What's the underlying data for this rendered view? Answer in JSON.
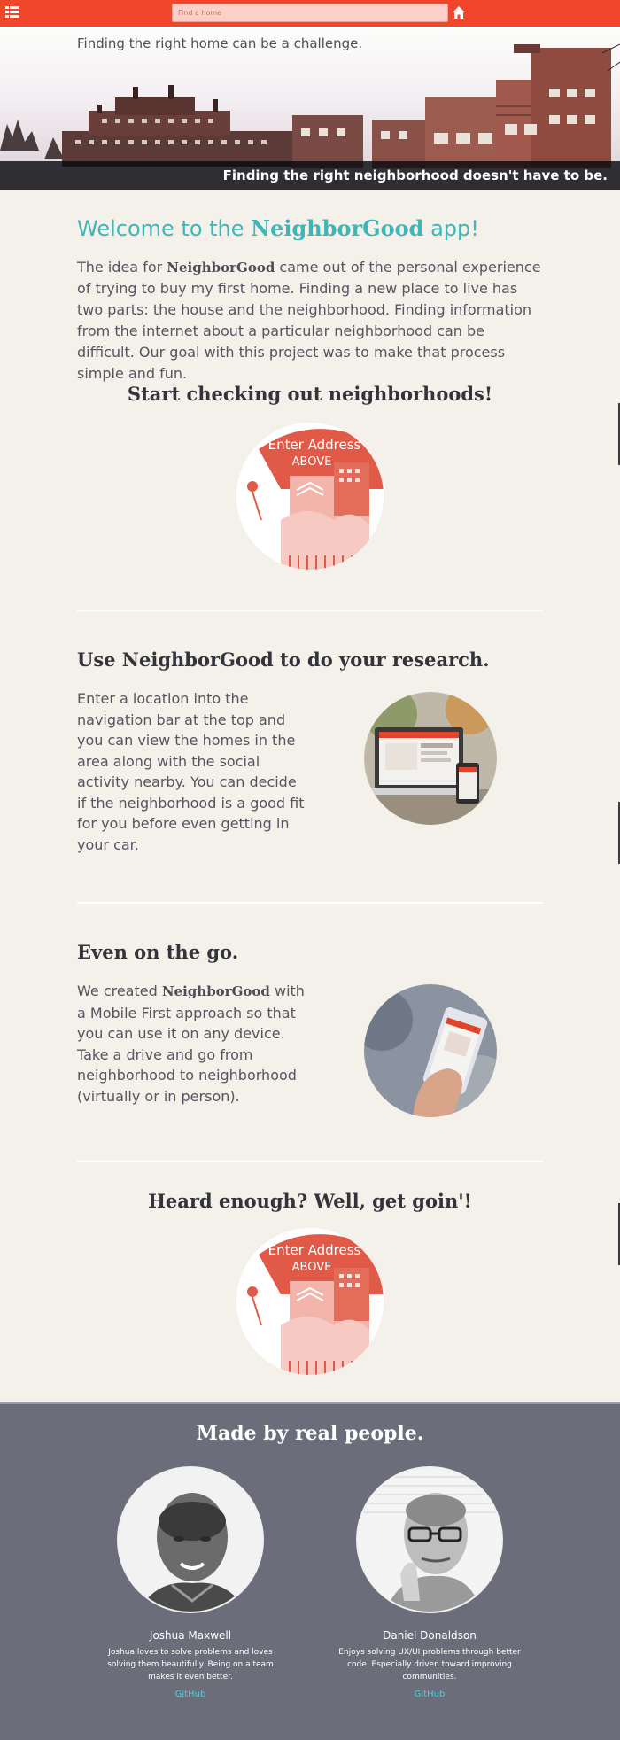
{
  "nav": {
    "search_placeholder": "Find a home"
  },
  "hero": {
    "top_text": "Finding the right home can be a challenge.",
    "caption": "Finding the right neighborhood doesn't have to be."
  },
  "welcome": {
    "prefix": "Welcome to the ",
    "brand": "NeighborGood",
    "suffix": " app!"
  },
  "intro": {
    "before": "The idea for ",
    "brand": "NeighborGood",
    "after": " came out of the personal experience of trying to buy my first home. Finding a new place to live has two parts: the house and the neighborhood. Finding information from the internet about a particular neighborhood can be difficult. Our goal with this project was to make that process simple and fun."
  },
  "start": {
    "heading": "Start checking out neighborhoods!",
    "badge_line1": "Enter Address",
    "badge_line2": "ABOVE"
  },
  "research": {
    "heading": "Use NeighborGood to do your research.",
    "text": "Enter a location into the navigation bar at the top and you can view the homes in the area along with the social activity nearby. You can decide if the neighborhood is a good fit for you before even getting in your car."
  },
  "mobile": {
    "heading": "Even on the go.",
    "before": "We created ",
    "brand": "NeighborGood",
    "after": " with a Mobile First approach so that you can use it on any device. Take a drive and go from neighborhood to neighborhood (virtually or in person)."
  },
  "goin": {
    "heading": "Heard enough? Well, get goin'!",
    "badge_line1": "Enter Address",
    "badge_line2": "ABOVE"
  },
  "footer": {
    "title": "Made by real people.",
    "people": [
      {
        "name": "Joshua Maxwell",
        "bio": "Joshua loves to solve problems and loves solving them beautifully. Being on a team makes it even better.",
        "link": "GitHub"
      },
      {
        "name": "Daniel Donaldson",
        "bio": "Enjoys solving UX/UI problems through better code. Especially driven toward improving communities.",
        "link": "GitHub"
      }
    ]
  },
  "colors": {
    "accent": "#f0462c",
    "teal": "#3fb5b6",
    "footer_bg": "#6c6d7b",
    "link": "#52d0d6"
  }
}
